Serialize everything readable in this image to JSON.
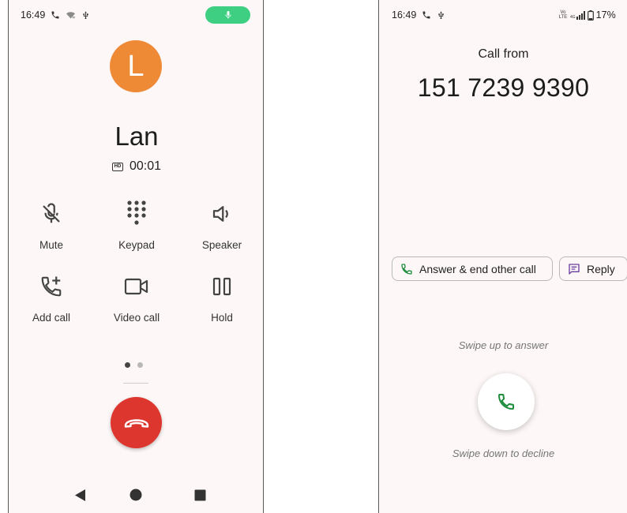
{
  "left_screen": {
    "status": {
      "time": "16:49",
      "icons": [
        "phone-icon",
        "wifi-icon",
        "usb-icon"
      ]
    },
    "mic_indicator": {
      "icon": "mic-icon",
      "color": "#3ecf83"
    },
    "caller": {
      "initial": "L",
      "name": "Lan",
      "duration": "00:01",
      "avatar_color": "#ee8a36"
    },
    "controls": [
      {
        "label": "Mute",
        "icon": "mic-off-icon"
      },
      {
        "label": "Keypad",
        "icon": "dialpad-icon"
      },
      {
        "label": "Speaker",
        "icon": "speaker-icon"
      },
      {
        "label": "Add call",
        "icon": "add-call-icon"
      },
      {
        "label": "Video call",
        "icon": "videocam-icon"
      },
      {
        "label": "Hold",
        "icon": "pause-icon"
      }
    ],
    "page_indicator": {
      "pages": 2,
      "active": 1
    },
    "end_call": {
      "icon": "call-end-icon",
      "color": "#dd362e"
    },
    "nav": [
      "back-icon",
      "home-icon",
      "recents-icon"
    ]
  },
  "right_screen": {
    "status": {
      "time": "16:49",
      "battery": "17%",
      "icons": [
        "phone-icon",
        "usb-icon",
        "volte-icon",
        "signal-icon",
        "battery-icon"
      ],
      "volte_text": "Vo LTE",
      "net_text": "4G"
    },
    "call_from": "Call from",
    "number": "151 7239 9390",
    "actions": [
      {
        "label": "Answer & end other call",
        "icon": "phone-icon"
      },
      {
        "label": "Reply",
        "icon": "message-icon"
      }
    ],
    "swipe_up": "Swipe up to answer",
    "swipe_down": "Swipe down to decline",
    "answer_button": {
      "icon": "phone-icon",
      "color": "#1e8e3e"
    }
  }
}
